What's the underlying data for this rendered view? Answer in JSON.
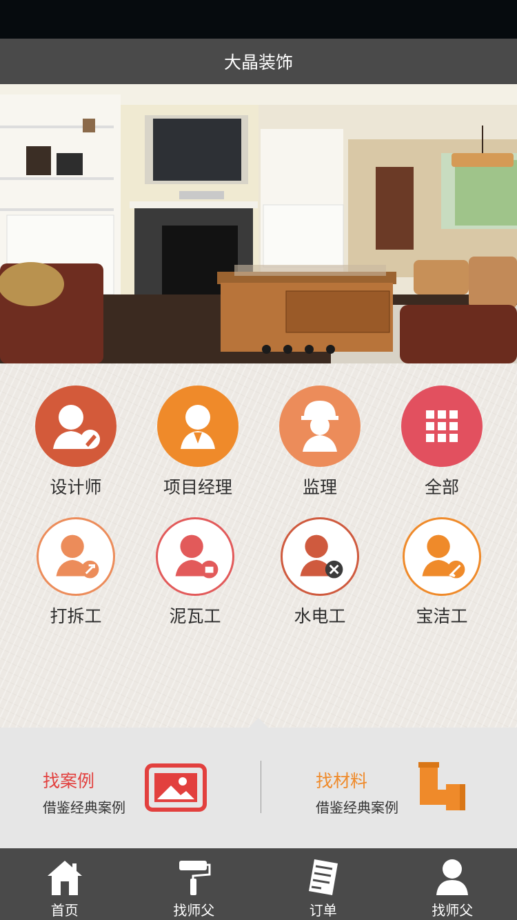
{
  "header": {
    "title": "大晶装饰"
  },
  "banner": {
    "slides": 4,
    "active_slide": 1
  },
  "categories": [
    {
      "label": "设计师",
      "icon": "designer-icon",
      "color": "#d35a3a"
    },
    {
      "label": "项目经理",
      "icon": "project-manager-icon",
      "color": "#ef8a2a"
    },
    {
      "label": "监理",
      "icon": "supervisor-icon",
      "color": "#ec8c5a"
    },
    {
      "label": "全部",
      "icon": "all-grid-icon",
      "color": "#e2505f"
    },
    {
      "label": "打拆工",
      "icon": "demolition-worker-icon",
      "color": "#ec8c5a"
    },
    {
      "label": "泥瓦工",
      "icon": "bricklayer-icon",
      "color": "#e25a5a"
    },
    {
      "label": "水电工",
      "icon": "electrician-icon",
      "color": "#cf5a3e"
    },
    {
      "label": "宝洁工",
      "icon": "cleaner-icon",
      "color": "#ef8a2a"
    }
  ],
  "find": {
    "cases": {
      "title": "找案例",
      "subtitle": "借鉴经典案例",
      "color": "#e2403e",
      "icon": "picture-frame-icon"
    },
    "materials": {
      "title": "找材料",
      "subtitle": "借鉴经典案例",
      "color": "#ef8a2a",
      "icon": "pipe-icon"
    }
  },
  "nav": [
    {
      "label": "首页",
      "icon": "home-icon"
    },
    {
      "label": "找师父",
      "icon": "paint-roller-icon"
    },
    {
      "label": "订单",
      "icon": "order-icon"
    },
    {
      "label": "找师父",
      "icon": "user-icon"
    }
  ]
}
